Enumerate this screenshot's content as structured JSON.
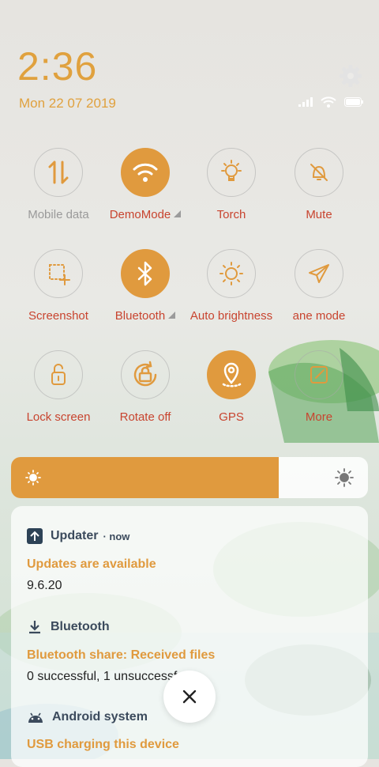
{
  "status": {
    "time": "2:36",
    "date": "Mon 22 07 2019"
  },
  "colors": {
    "accent": "#e09a3e",
    "label": "#c8442f"
  },
  "tiles": [
    {
      "label": "Mobile data",
      "icon": "swap-vert-icon",
      "active": false
    },
    {
      "label": "DemoMode",
      "icon": "wifi-icon",
      "active": true
    },
    {
      "label": "Torch",
      "icon": "torch-icon",
      "active": false
    },
    {
      "label": "Mute",
      "icon": "mute-icon",
      "active": false
    },
    {
      "label": "Screenshot",
      "icon": "screenshot-icon",
      "active": false
    },
    {
      "label": "Bluetooth",
      "icon": "bluetooth-icon",
      "active": true
    },
    {
      "label": "Auto brightness",
      "icon": "brightness-icon",
      "active": false
    },
    {
      "label": "ane mode",
      "icon": "airplane-icon",
      "active": false
    },
    {
      "label": "Lock screen",
      "icon": "lock-icon",
      "active": false
    },
    {
      "label": "Rotate off",
      "icon": "rotate-lock-icon",
      "active": false
    },
    {
      "label": "GPS",
      "icon": "gps-icon",
      "active": true
    },
    {
      "label": "More",
      "icon": "edit-icon",
      "active": false
    }
  ],
  "brightness": {
    "level": 0.75
  },
  "notifications": [
    {
      "app": "Updater",
      "time": "now",
      "title": "Updates are available",
      "body": "9.6.20"
    },
    {
      "app": "Bluetooth",
      "title": "Bluetooth share: Received files",
      "body": "0 successful, 1 unsuccessful."
    },
    {
      "app": "Android system",
      "title": "USB charging this device"
    }
  ]
}
